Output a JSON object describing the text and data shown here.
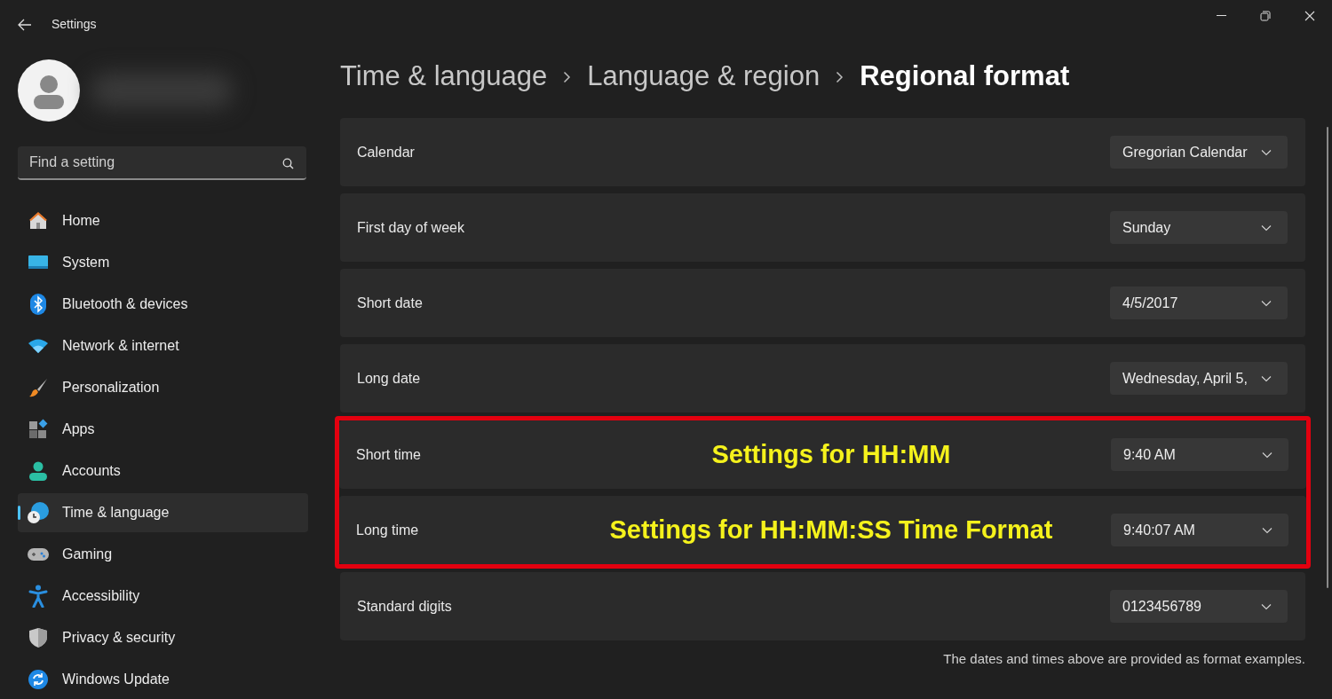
{
  "window": {
    "title": "Settings"
  },
  "search": {
    "placeholder": "Find a setting"
  },
  "sidebar": {
    "items": [
      {
        "label": "Home",
        "selected": false
      },
      {
        "label": "System",
        "selected": false
      },
      {
        "label": "Bluetooth & devices",
        "selected": false
      },
      {
        "label": "Network & internet",
        "selected": false
      },
      {
        "label": "Personalization",
        "selected": false
      },
      {
        "label": "Apps",
        "selected": false
      },
      {
        "label": "Accounts",
        "selected": false
      },
      {
        "label": "Time & language",
        "selected": true
      },
      {
        "label": "Gaming",
        "selected": false
      },
      {
        "label": "Accessibility",
        "selected": false
      },
      {
        "label": "Privacy & security",
        "selected": false
      },
      {
        "label": "Windows Update",
        "selected": false
      }
    ]
  },
  "breadcrumb": [
    "Time & language",
    "Language & region",
    "Regional format"
  ],
  "rows": [
    {
      "label": "Calendar",
      "value": "Gregorian Calendar",
      "highlighted": false
    },
    {
      "label": "First day of week",
      "value": "Sunday",
      "highlighted": false
    },
    {
      "label": "Short date",
      "value": "4/5/2017",
      "highlighted": false
    },
    {
      "label": "Long date",
      "value": "Wednesday, April 5,",
      "highlighted": false
    },
    {
      "label": "Short time",
      "value": "9:40 AM",
      "highlighted": true,
      "annotation": "Settings for HH:MM"
    },
    {
      "label": "Long time",
      "value": "9:40:07 AM",
      "highlighted": true,
      "annotation": "Settings for HH:MM:SS Time Format"
    },
    {
      "label": "Standard digits",
      "value": "0123456789",
      "highlighted": false
    }
  ],
  "footnote": "The dates and times above are provided as format examples."
}
